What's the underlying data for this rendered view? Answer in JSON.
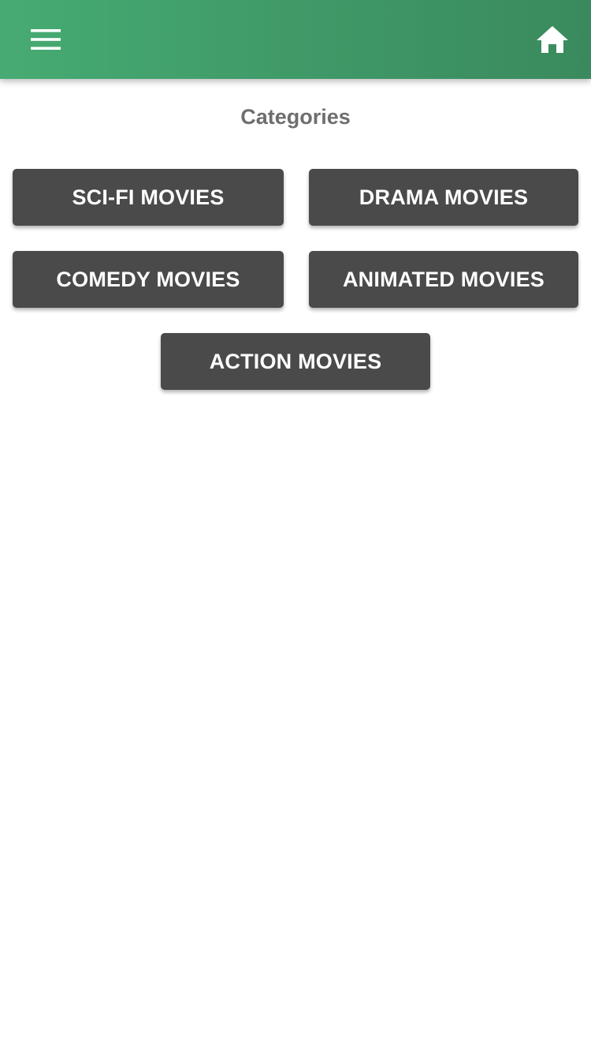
{
  "header": {
    "menu_icon": "hamburger-menu-icon",
    "home_icon": "home-icon",
    "colors": {
      "gradient_start": "#46ab72",
      "gradient_end": "#3a8a5d",
      "icon": "#ffffff"
    }
  },
  "page": {
    "title": "Categories"
  },
  "categories": [
    {
      "label": "SCI-FI MOVIES"
    },
    {
      "label": "DRAMA MOVIES"
    },
    {
      "label": "COMEDY MOVIES"
    },
    {
      "label": "ANIMATED MOVIES"
    },
    {
      "label": "ACTION MOVIES"
    }
  ],
  "colors": {
    "button_bg": "#4a4a4a",
    "button_text": "#ffffff",
    "title_text": "#6e6e6e"
  }
}
